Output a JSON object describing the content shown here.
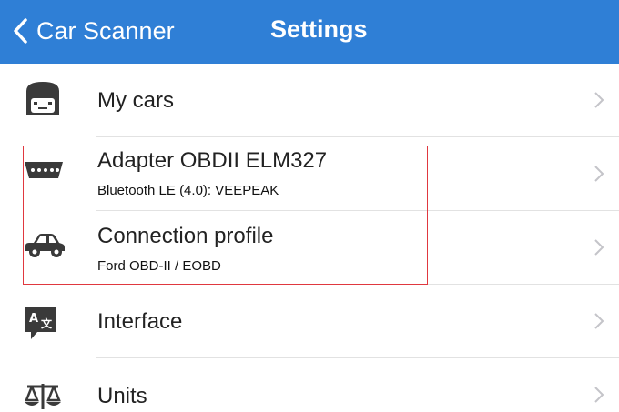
{
  "navbar": {
    "back_label": "Car Scanner",
    "title": "Settings",
    "color": "#2f7fd6"
  },
  "settings": {
    "items": [
      {
        "label": "My cars",
        "icon": "garage-icon"
      },
      {
        "label": "Adapter OBDII ELM327",
        "sublabel": "Bluetooth LE (4.0): VEEPEAK",
        "icon": "obd-connector-icon"
      },
      {
        "label": "Connection profile",
        "sublabel": "Ford OBD-II / EOBD",
        "icon": "car-icon"
      },
      {
        "label": "Interface",
        "icon": "translate-icon"
      },
      {
        "label": "Units",
        "icon": "scales-icon"
      }
    ]
  },
  "highlight_color": "#e0383f"
}
